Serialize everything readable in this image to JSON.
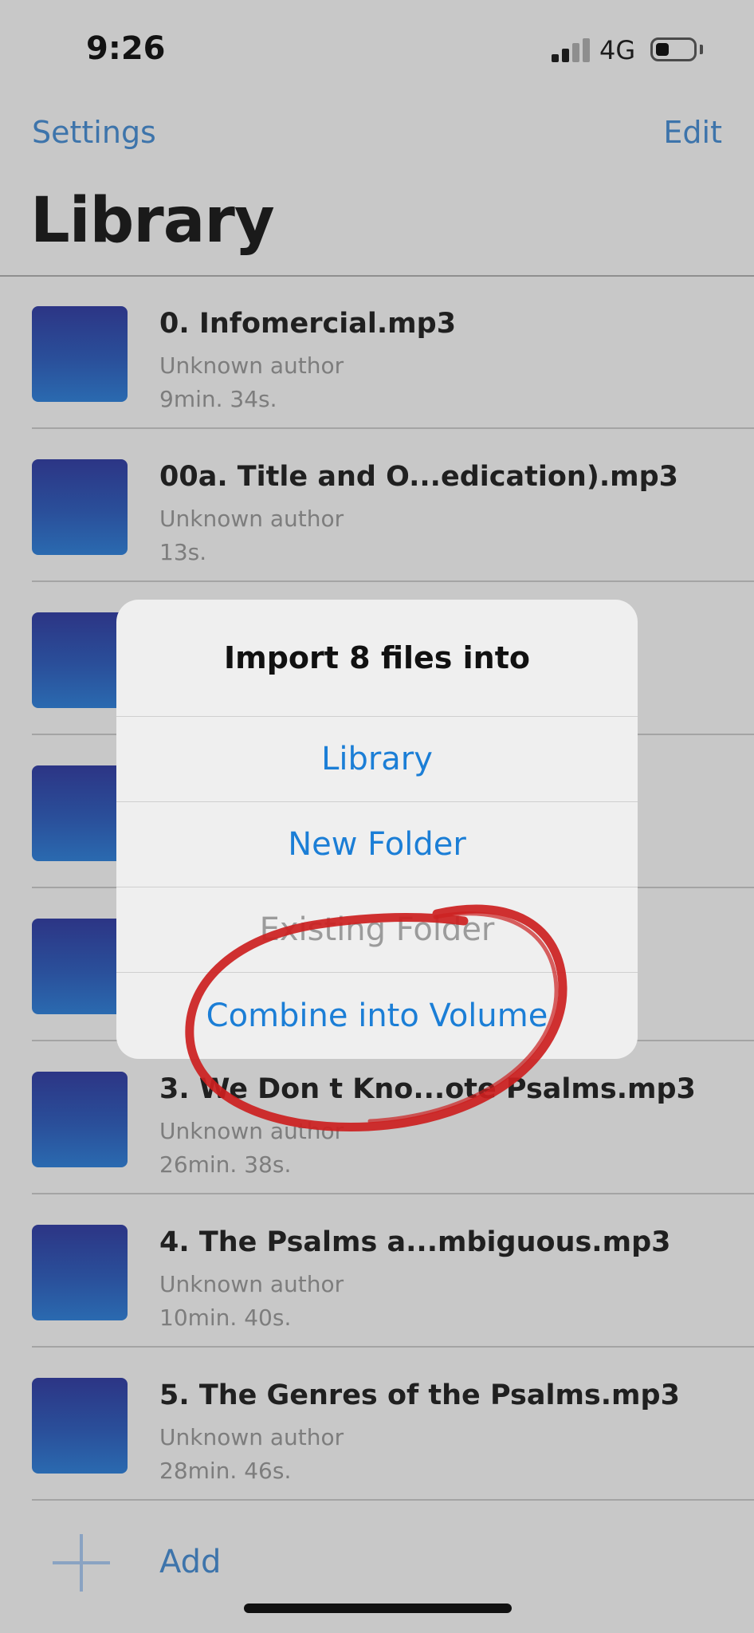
{
  "status_bar": {
    "time": "9:26",
    "network": "4G",
    "battery_level": 0.3,
    "signal_bars": 2
  },
  "nav": {
    "settings_label": "Settings",
    "edit_label": "Edit",
    "title": "Library"
  },
  "library_items": [
    {
      "title": "0. Infomercial.mp3",
      "author": "Unknown author",
      "duration": "9min. 34s."
    },
    {
      "title": "00a. Title and O...edication).mp3",
      "author": "Unknown author",
      "duration": "13s."
    },
    {
      "title": "",
      "author": "",
      "duration": ""
    },
    {
      "title": "",
      "author": "",
      "duration": ""
    },
    {
      "title": "",
      "author": "",
      "duration": ""
    },
    {
      "title": "3. We Don t Kno...ote Psalms.mp3",
      "author": "Unknown author",
      "duration": "26min. 38s."
    },
    {
      "title": "4. The Psalms a...mbiguous.mp3",
      "author": "Unknown author",
      "duration": "10min. 40s."
    },
    {
      "title": "5. The Genres of the Psalms.mp3",
      "author": "Unknown author",
      "duration": "28min. 46s."
    }
  ],
  "add": {
    "label": "Add",
    "icon": "plus-icon"
  },
  "dialog": {
    "title": "Import 8 files into",
    "options": [
      {
        "label": "Library",
        "enabled": true
      },
      {
        "label": "New Folder",
        "enabled": true
      },
      {
        "label": "Existing Folder",
        "enabled": false
      },
      {
        "label": "Combine into Volume",
        "enabled": true
      }
    ]
  },
  "colors": {
    "link": "#3d74ab",
    "dialog_action": "#1b7ed6",
    "disabled": "#9b9b9b",
    "annotation": "#cc2020",
    "thumbnail_top": "#2c3585",
    "thumbnail_bottom": "#2a6ab0"
  }
}
